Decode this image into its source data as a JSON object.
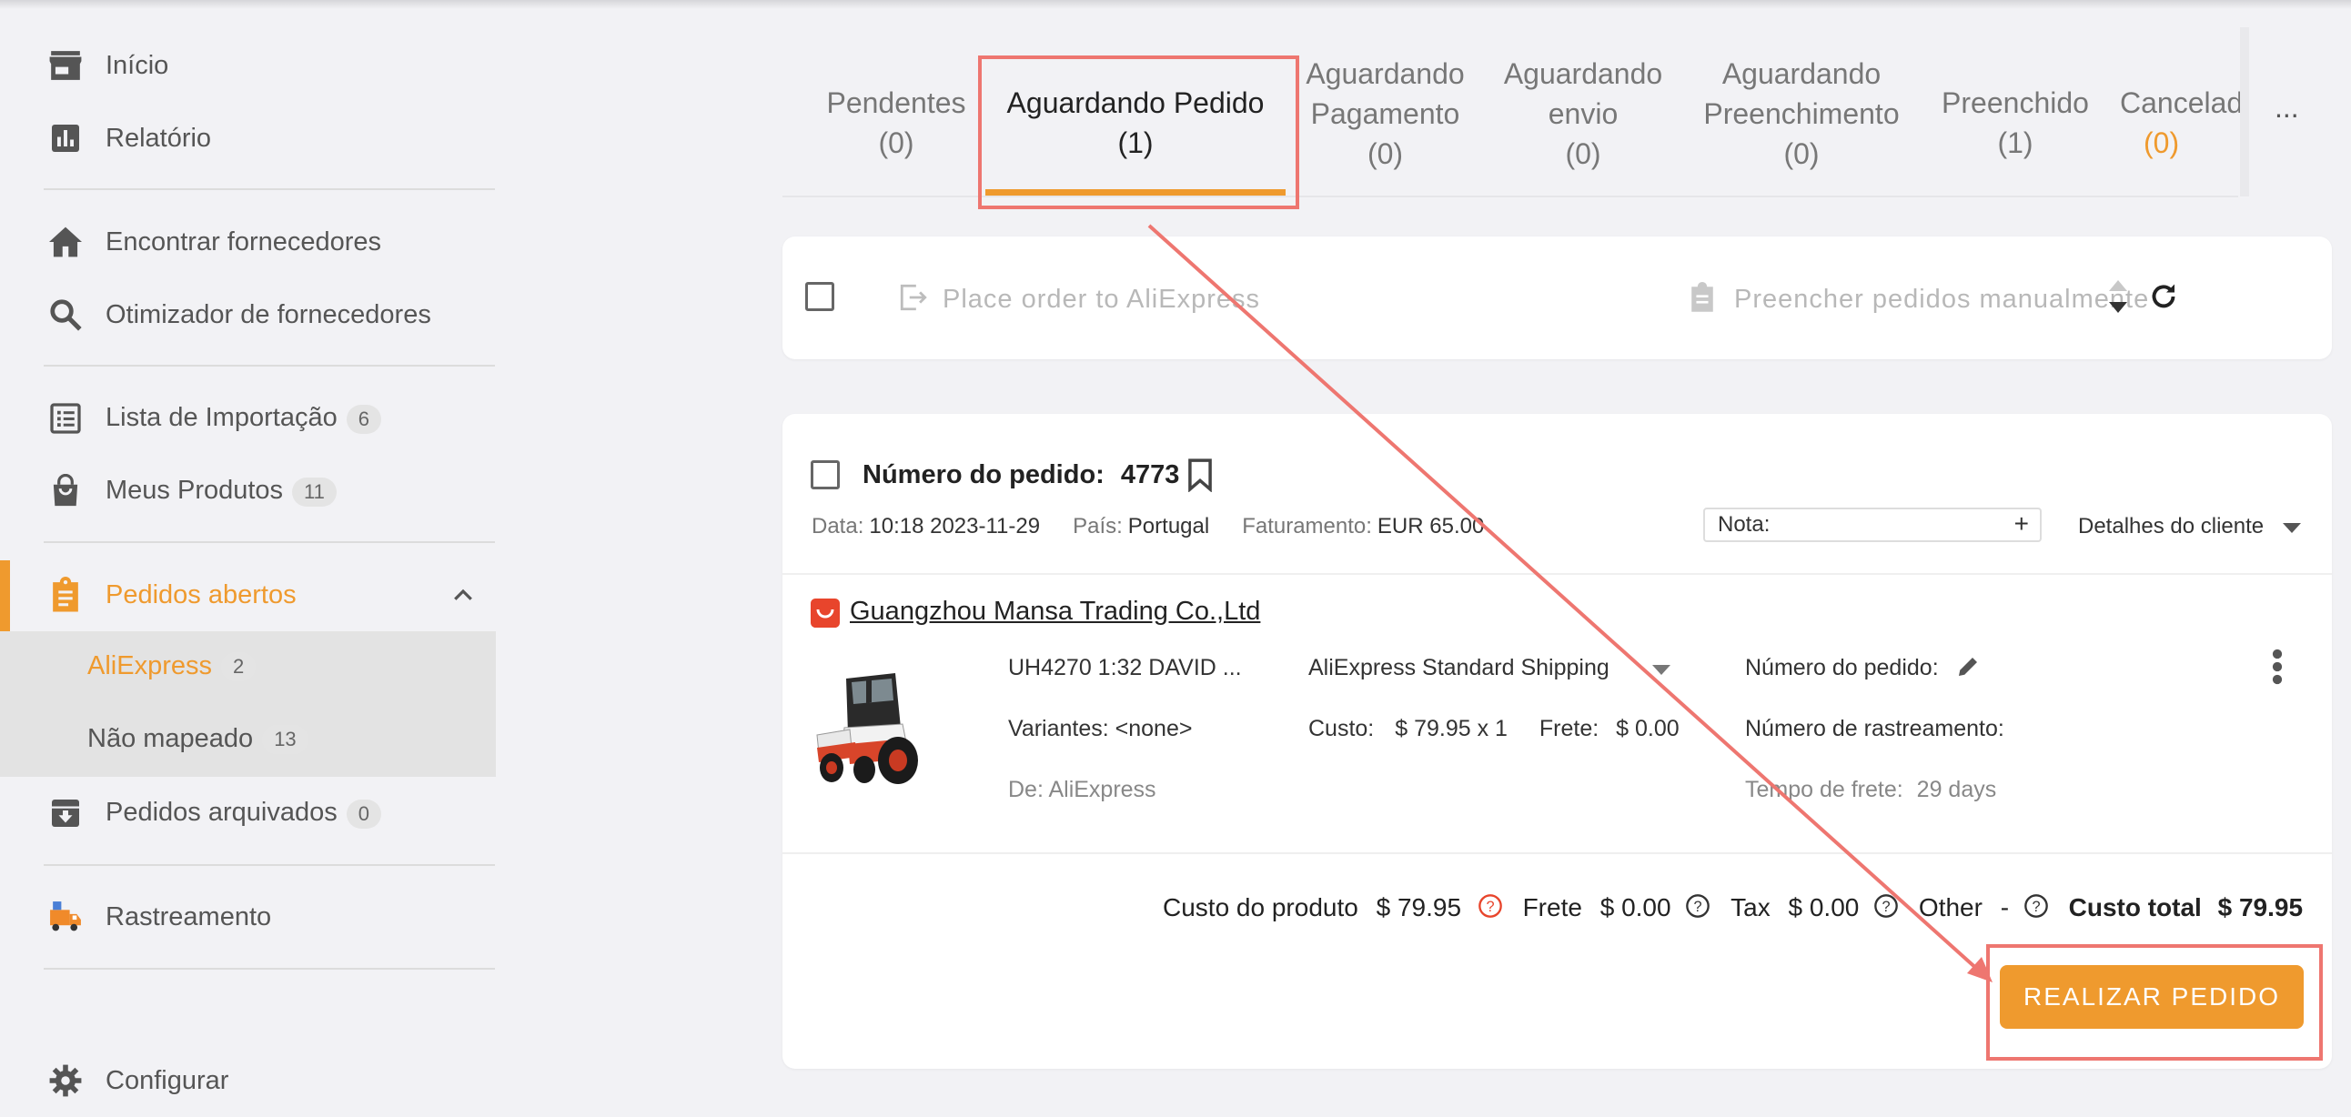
{
  "sidebar": {
    "items": [
      {
        "label": "Início",
        "icon": "store-icon"
      },
      {
        "label": "Relatório",
        "icon": "report-chart-icon"
      },
      {
        "label": "Encontrar fornecedores",
        "icon": "home-icon"
      },
      {
        "label": "Otimizador de fornecedores",
        "icon": "search-icon"
      },
      {
        "label": "Lista de Importação",
        "badge": "6",
        "icon": "list-icon"
      },
      {
        "label": "Meus Produtos",
        "badge": "11",
        "icon": "shopping-bag-icon"
      },
      {
        "label": "Pedidos abertos",
        "icon": "clipboard-icon",
        "active": true
      },
      {
        "label": "Pedidos arquivados",
        "badge": "0",
        "icon": "archive-icon"
      },
      {
        "label": "Rastreamento",
        "icon": "delivery-truck-icon"
      },
      {
        "label": "Configurar",
        "icon": "gear-icon"
      }
    ],
    "submenu": [
      {
        "label": "AliExpress",
        "badge": "2",
        "active": true
      },
      {
        "label": "Não mapeado",
        "badge": "13"
      }
    ]
  },
  "tabs": [
    {
      "line1": "Pendentes",
      "line2": "",
      "count": "(0)"
    },
    {
      "line1": "Aguardando Pedido",
      "line2": "",
      "count": "(1)",
      "active": true
    },
    {
      "line1": "Aguardando",
      "line2": "Pagamento",
      "count": "(0)"
    },
    {
      "line1": "Aguardando",
      "line2": "envio",
      "count": "(0)"
    },
    {
      "line1": "Aguardando",
      "line2": "Preenchimento",
      "count": "(0)"
    },
    {
      "line1": "Preenchido",
      "line2": "",
      "count": "(1)"
    },
    {
      "line1": "Cancelado",
      "line2": "",
      "count": "(0)"
    }
  ],
  "tab_more": "...",
  "bulk": {
    "place_order": "Place order to AliExpress",
    "fill_manual": "Preencher pedidos manualmente"
  },
  "order": {
    "number_label": "Número do pedido:",
    "number": "4773",
    "date_label": "Data:",
    "date": "10:18 2023-11-29",
    "country_label": "País:",
    "country": "Portugal",
    "billing_label": "Faturamento:",
    "billing": "EUR 65.00",
    "note_label": "Nota:",
    "note_plus": "+",
    "customer_details": "Detalhes do cliente",
    "supplier": "Guangzhou Mansa Trading Co.,Ltd",
    "product": {
      "title": "UH4270 1:32 DAVID ...",
      "variants": "Variantes: <none>",
      "from": "De: AliExpress",
      "shipping_method": "AliExpress Standard Shipping",
      "cost_label": "Custo:",
      "cost": "$ 79.95 x 1",
      "freight_label": "Frete:",
      "freight": "$ 0.00",
      "order_number_label": "Número do pedido:",
      "tracking_label": "Número de rastreamento:",
      "shipping_time_label": "Tempo de frete:",
      "shipping_time": "29 days"
    },
    "summary": {
      "product_cost_label": "Custo do produto",
      "product_cost": "$ 79.95",
      "freight_label": "Frete",
      "freight": "$ 0.00",
      "tax_label": "Tax",
      "tax": "$ 0.00",
      "other_label": "Other",
      "other": "-",
      "total_label": "Custo total",
      "total": "$ 79.95"
    },
    "place_order_button": "REALIZAR PEDIDO"
  },
  "colors": {
    "accent": "#ef9a2e",
    "annotation": "#ee7670",
    "aliexpress_red": "#e8452c"
  }
}
